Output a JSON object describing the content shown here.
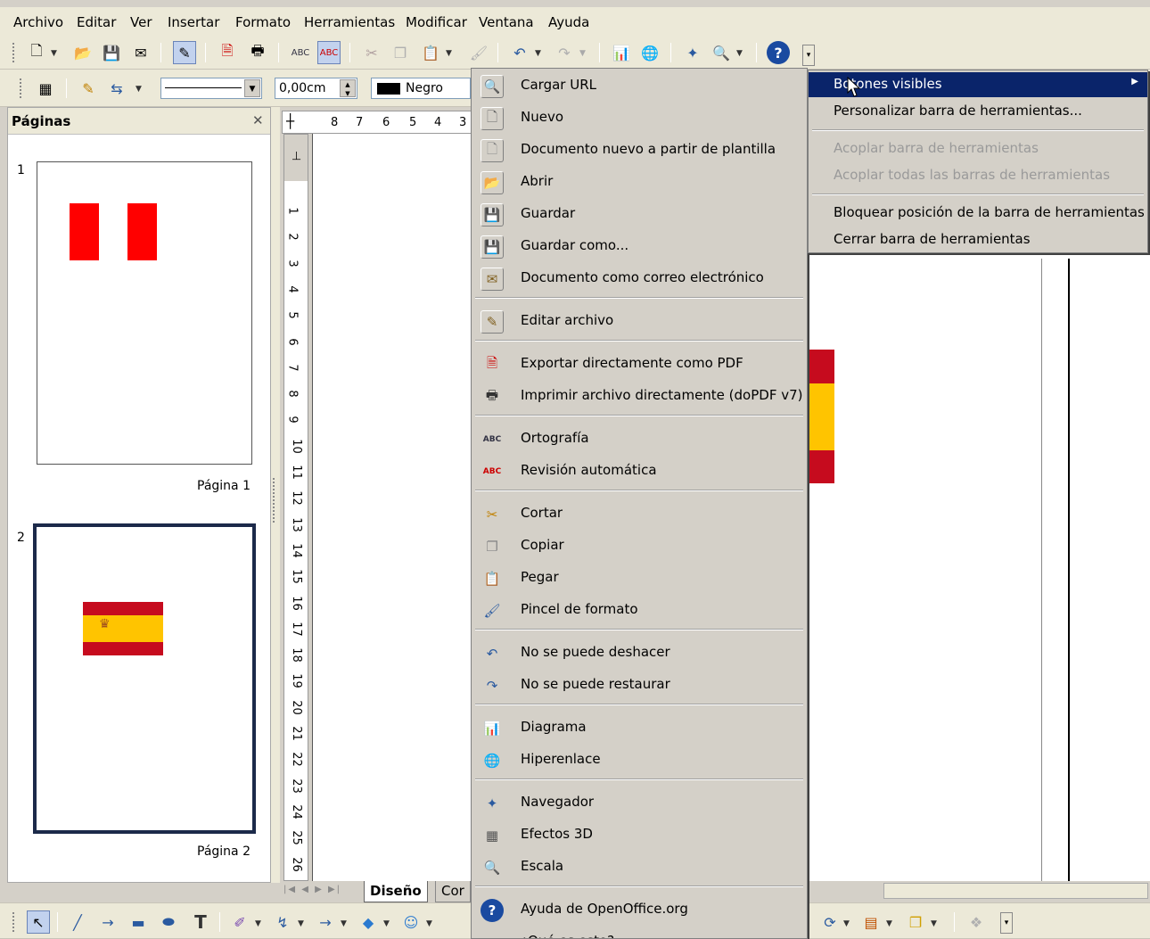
{
  "menubar": [
    "Archivo",
    "Editar",
    "Ver",
    "Insertar",
    "Formato",
    "Herramientas",
    "Modificar",
    "Ventana",
    "Ayuda"
  ],
  "toolbar2": {
    "line_width": "0,00cm",
    "color_name": "Negro"
  },
  "pages_panel": {
    "title": "Páginas",
    "close": "✕",
    "pages": [
      {
        "number": "1",
        "label": "Página 1"
      },
      {
        "number": "2",
        "label": "Página 2"
      }
    ]
  },
  "ruler_h": [
    "8",
    "7",
    "6",
    "5",
    "4",
    "3"
  ],
  "ruler_v": [
    "1",
    "2",
    "3",
    "4",
    "5",
    "6",
    "7",
    "8",
    "9",
    "10",
    "11",
    "12",
    "13",
    "14",
    "15",
    "16",
    "17",
    "18",
    "19",
    "20",
    "21",
    "22",
    "23",
    "24",
    "25",
    "26"
  ],
  "tabs": {
    "design": "Diseño",
    "other": "Cor"
  },
  "context_menu": {
    "items": [
      {
        "label": "Cargar URL",
        "icon": "load-url-icon"
      },
      {
        "label": "Nuevo",
        "icon": "new-icon"
      },
      {
        "label": "Documento nuevo a partir de plantilla",
        "icon": "template-icon"
      },
      {
        "label": "Abrir",
        "icon": "open-icon"
      },
      {
        "label": "Guardar",
        "icon": "save-icon"
      },
      {
        "label": "Guardar como...",
        "icon": "save-as-icon"
      },
      {
        "label": "Documento como correo electrónico",
        "icon": "email-icon"
      },
      {
        "label": "Editar archivo",
        "icon": "edit-file-icon"
      },
      {
        "label": "Exportar directamente como PDF",
        "icon": "pdf-icon"
      },
      {
        "label": "Imprimir archivo directamente (doPDF v7)",
        "icon": "print-icon"
      },
      {
        "label": "Ortografía",
        "icon": "spellcheck-icon"
      },
      {
        "label": "Revisión automática",
        "icon": "autospell-icon"
      },
      {
        "label": "Cortar",
        "icon": "cut-icon"
      },
      {
        "label": "Copiar",
        "icon": "copy-icon"
      },
      {
        "label": "Pegar",
        "icon": "paste-icon"
      },
      {
        "label": "Pincel de formato",
        "icon": "format-brush-icon"
      },
      {
        "label": "No se puede deshacer",
        "icon": "undo-icon"
      },
      {
        "label": "No se puede restaurar",
        "icon": "redo-icon"
      },
      {
        "label": "Diagrama",
        "icon": "chart-icon"
      },
      {
        "label": "Hiperenlace",
        "icon": "hyperlink-icon"
      },
      {
        "label": "Navegador",
        "icon": "navigator-icon"
      },
      {
        "label": "Efectos 3D",
        "icon": "3d-effects-icon"
      },
      {
        "label": "Escala",
        "icon": "zoom-icon"
      },
      {
        "label": "Ayuda de OpenOffice.org",
        "icon": "help-icon"
      },
      {
        "label": "¿Qué es esto?",
        "icon": ""
      }
    ]
  },
  "submenu": {
    "items": [
      {
        "label": "Botones visibles",
        "state": "highlighted"
      },
      {
        "label": "Personalizar barra de herramientas...",
        "state": "normal"
      },
      {
        "label": "Acoplar barra de herramientas",
        "state": "disabled"
      },
      {
        "label": "Acoplar todas las barras de herramientas",
        "state": "disabled"
      },
      {
        "label": "Bloquear posición de la barra de herramientas",
        "state": "normal"
      },
      {
        "label": "Cerrar barra de herramientas",
        "state": "normal"
      }
    ]
  },
  "colors": {
    "peru_red": "#ff0000",
    "spain_red": "#c60b1e",
    "spain_yellow": "#ffc400",
    "highlight": "#0a246a"
  }
}
